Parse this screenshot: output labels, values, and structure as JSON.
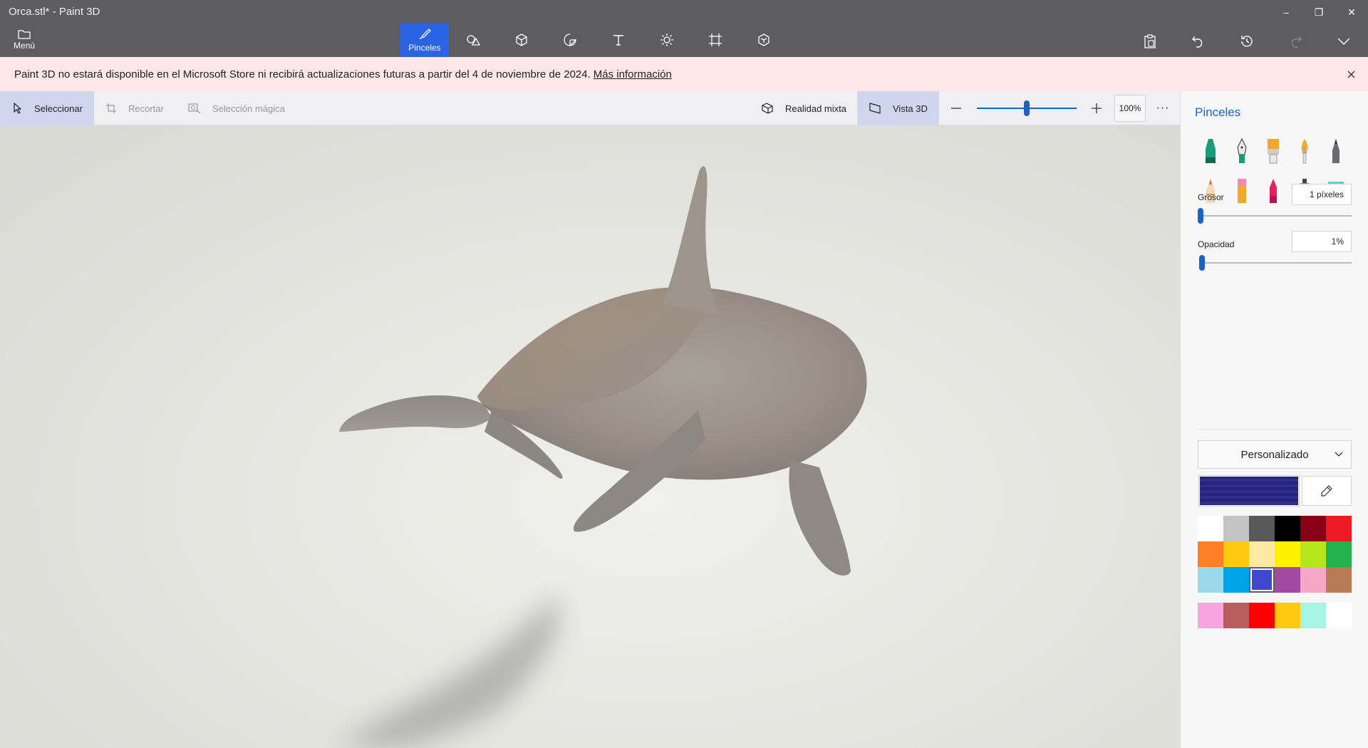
{
  "window": {
    "title": "Orca.stl* - Paint 3D",
    "minimize": "–",
    "restore": "❐",
    "close": "✕"
  },
  "toolbar": {
    "menu_label": "Menú",
    "active_tool_label": "Pinceles",
    "tools": [
      "brush-icon",
      "2d-shapes-icon",
      "3d-shapes-icon",
      "stickers-icon",
      "text-icon",
      "effects-icon",
      "canvas-icon",
      "3d-library-icon"
    ],
    "right_tools": [
      "paste-icon",
      "undo-icon",
      "history-icon",
      "redo-icon",
      "expand-icon"
    ]
  },
  "banner": {
    "message": "Paint 3D no estará disponible en el Microsoft Store ni recibirá actualizaciones futuras a partir del 4 de noviembre de 2024.",
    "link": "Más información"
  },
  "subbar": {
    "select": "Seleccionar",
    "crop": "Recortar",
    "magic_select": "Selección mágica",
    "mixed_reality": "Realidad mixta",
    "view_3d": "Vista 3D",
    "zoom": "100%",
    "zoom_level": 0.5,
    "more": "···"
  },
  "panel": {
    "title": "Pinceles",
    "brushes": [
      "marker",
      "calligraphy-pen",
      "oil-brush",
      "watercolor",
      "pencil",
      "crayon",
      "pixel-pen",
      "spray-can",
      "eraser",
      "fill"
    ],
    "thickness_label": "Grosor",
    "thickness_value": "1 píxeles",
    "thickness_level": 0.0,
    "opacity_label": "Opacidad",
    "opacity_value": "1%",
    "opacity_level": 0.01,
    "palette_mode": "Personalizado",
    "colors": {
      "current": "#27277f",
      "palette": [
        "#ffffff",
        "#c3c3c3",
        "#595959",
        "#000000",
        "#880015",
        "#ed1c24",
        "#ff7f27",
        "#ffc90e",
        "#fde9a4",
        "#fff200",
        "#b5e61d",
        "#22b14c",
        "#99d9ea",
        "#00a2e8",
        "#3f48cc",
        "#a349a4",
        "#f7a6c5",
        "#b97a57"
      ],
      "selected_index": 14,
      "custom": [
        "#f9a3e1",
        "#b85c5c",
        "#ff0000",
        "#ffc90e",
        "#a6f5e4",
        "#ffffff"
      ]
    }
  }
}
